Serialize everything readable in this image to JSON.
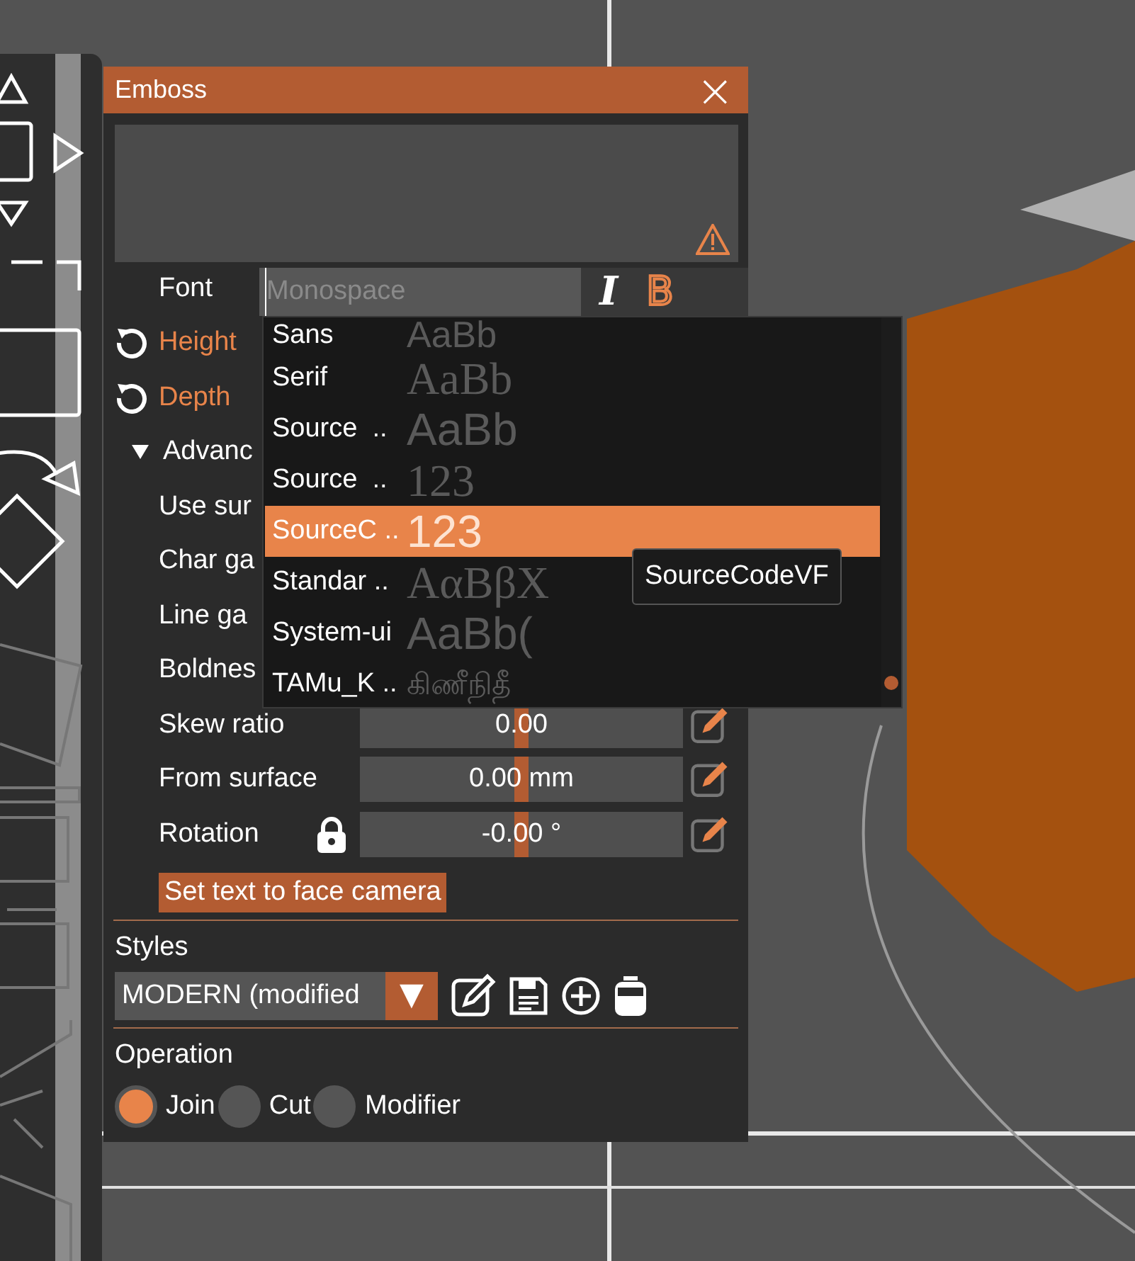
{
  "window": {
    "title": "Emboss",
    "close": "×"
  },
  "font": {
    "label": "Font",
    "placeholder": "Monospace",
    "italic": {
      "glyph": "I",
      "on": false
    },
    "bold": {
      "glyph": "B",
      "on": true
    }
  },
  "properties": [
    {
      "kind": "reset",
      "label": "Height"
    },
    {
      "kind": "reset",
      "label": "Depth"
    },
    {
      "kind": "section",
      "label": "Advanc",
      "expanded": true
    },
    {
      "kind": "label",
      "label": "Use sur"
    },
    {
      "kind": "label",
      "label": "Char ga"
    },
    {
      "kind": "label",
      "label": "Line ga"
    },
    {
      "kind": "label",
      "label": "Boldnes"
    },
    {
      "kind": "slider",
      "label": "Skew ratio",
      "value": "0.00",
      "level": 0.5
    },
    {
      "kind": "slider",
      "label": "From surface",
      "value": "0.00 mm",
      "level": 0.5
    },
    {
      "kind": "locked-slider",
      "label": "Rotation",
      "value": "-0.00 °",
      "level": 0.5
    }
  ],
  "face_camera_button": "Set text to face camera",
  "styles": {
    "label": "Styles",
    "value": "MODERN (modified",
    "arrow": "▼"
  },
  "operation": {
    "label": "Operation",
    "options": [
      {
        "label": "Join",
        "selected": true
      },
      {
        "label": "Cut",
        "selected": false
      },
      {
        "label": "Modifier",
        "selected": false
      }
    ]
  },
  "font_list": {
    "items": [
      {
        "label": "Sans",
        "sample": "AaBb",
        "kind": "sans",
        "selected": false
      },
      {
        "label": "Serif",
        "sample": "AaBb",
        "kind": "serif",
        "selected": false
      },
      {
        "label": "Source  ..",
        "sample": "AaBb",
        "kind": "sans",
        "selected": false
      },
      {
        "label": "Source  ..",
        "sample": "123",
        "kind": "serif",
        "selected": false
      },
      {
        "label": "SourceC ..",
        "sample": "123",
        "kind": "sans",
        "selected": true
      },
      {
        "label": "Standar ..",
        "sample": "AαBβX",
        "kind": "serif",
        "selected": false
      },
      {
        "label": "System-ui",
        "sample": "AaBb(",
        "kind": "sans",
        "selected": false
      },
      {
        "label": "TAMu_K ..",
        "sample": "கிணீநிதீ",
        "kind": "serif",
        "selected": false
      }
    ],
    "tooltip": "SourceCodeVF"
  }
}
